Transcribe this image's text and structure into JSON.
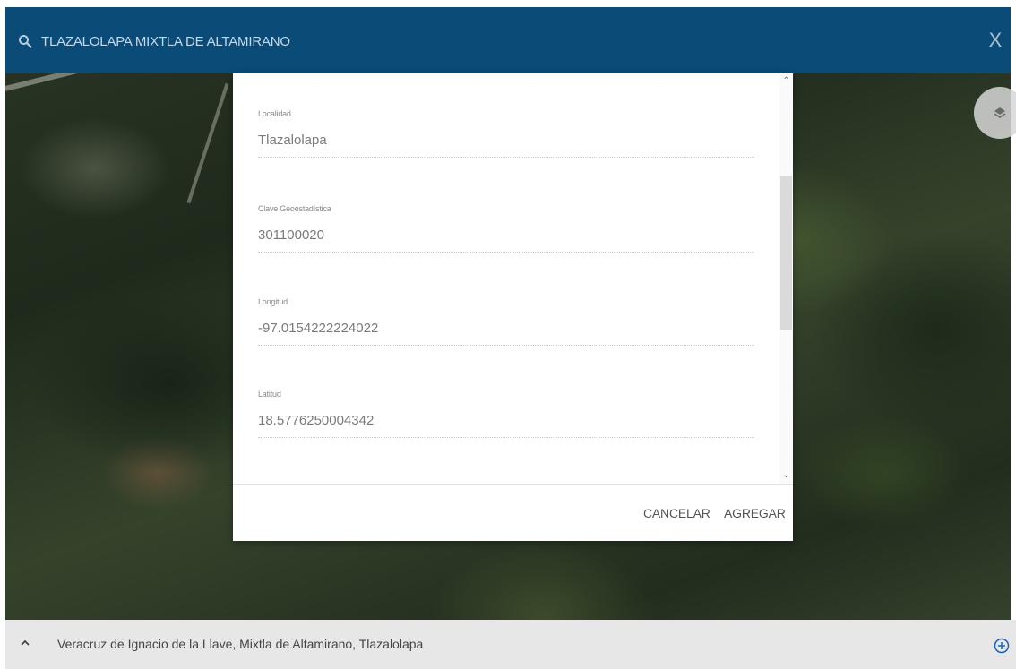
{
  "search": {
    "query": "TLAZALOLAPA MIXTLA DE ALTAMIRANO"
  },
  "icons": {
    "search": "search-icon",
    "close": "close-icon",
    "layers": "layers-icon",
    "expand": "chevron-up-icon",
    "add": "add-circle-icon"
  },
  "close_label": "X",
  "dialog": {
    "fields": [
      {
        "label": "Localidad",
        "value": "Tlazalolapa"
      },
      {
        "label": "Clave Geoestadística",
        "value": "301100020"
      },
      {
        "label": "Longitud",
        "value": "-97.0154222224022"
      },
      {
        "label": "Latitud",
        "value": "18.5776250004342"
      }
    ],
    "cancel_label": "CANCELAR",
    "add_label": "AGREGAR"
  },
  "bottom_bar": {
    "location": "Veracruz de Ignacio de la Llave, Mixtla de Altamirano, Tlazalolapa"
  },
  "colors": {
    "header_bg": "#0a4b78",
    "header_text": "#c8d7e4",
    "accent_blue": "#1565c0"
  }
}
